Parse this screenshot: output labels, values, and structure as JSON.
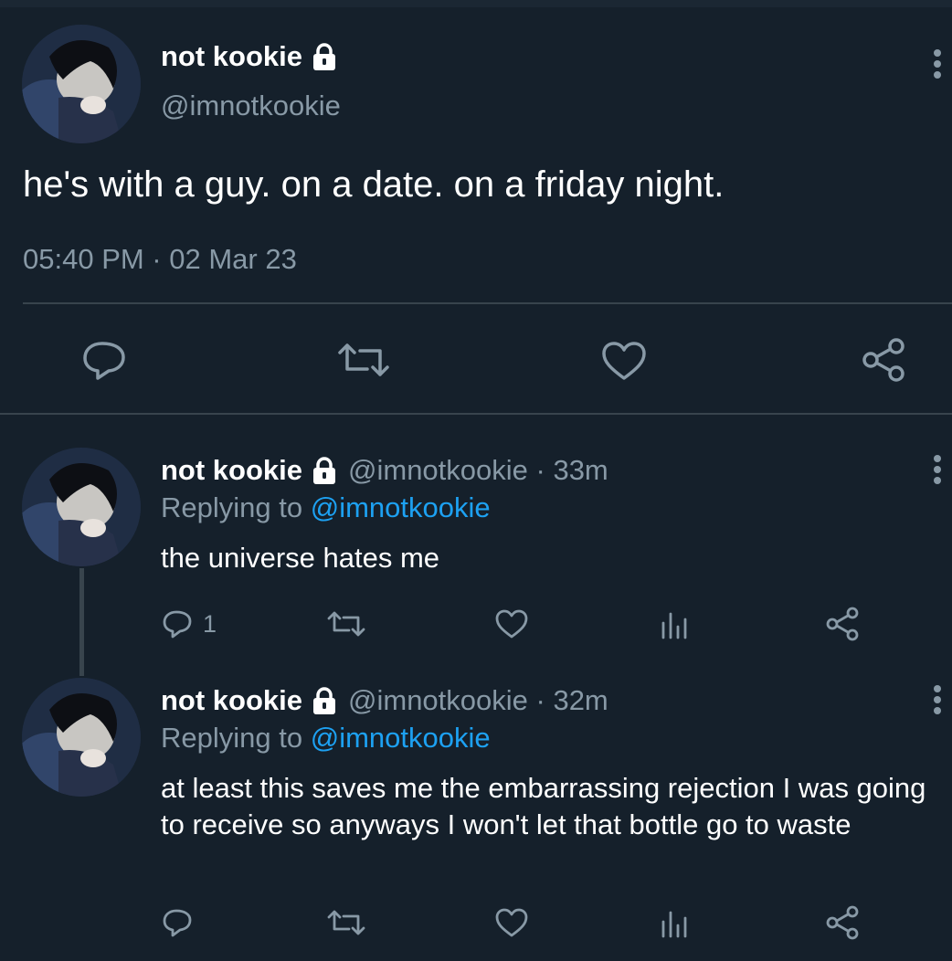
{
  "main_tweet": {
    "display_name": "not kookie",
    "handle": "@imnotkookie",
    "text": "he's with a guy. on a date. on a friday night.",
    "timestamp": "05:40 PM · 02 Mar 23",
    "actions": [
      "reply-icon",
      "retweet-icon",
      "like-icon",
      "share-icon"
    ]
  },
  "replies": [
    {
      "display_name": "not kookie",
      "meta": "@imnotkookie · 33m",
      "replying_prefix": "Replying to ",
      "replying_to": "@imnotkookie",
      "text": "the universe hates me",
      "reply_count": "1"
    },
    {
      "display_name": "not kookie",
      "meta": "@imnotkookie · 32m",
      "replying_prefix": "Replying to ",
      "replying_to": "@imnotkookie",
      "text": "at least this saves me the embarrassing rejection I was going to receive so anyways I won't let that bottle go to waste",
      "reply_count": ""
    }
  ],
  "colors": {
    "background": "#15202b",
    "secondary_text": "#8899a6",
    "link": "#1da1f2",
    "divider": "#38444d"
  }
}
